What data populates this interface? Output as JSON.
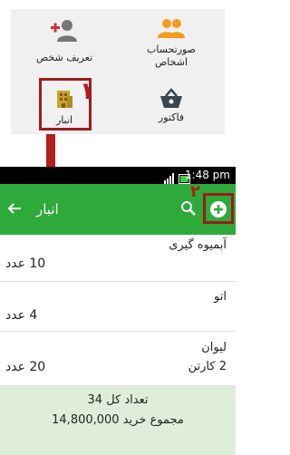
{
  "top_panel": {
    "tiles": [
      {
        "label": "تعریف شخص",
        "icon": "add-person-icon"
      },
      {
        "label": "صورتحساب\nاشخاص",
        "icon": "people-icon"
      },
      {
        "label": "انبار",
        "icon": "warehouse-icon"
      },
      {
        "label": "فاکتور",
        "icon": "basket-icon"
      }
    ],
    "marker1": "۱",
    "marker2": "۲"
  },
  "status_bar": {
    "time": "1:48 pm"
  },
  "toolbar": {
    "title": "انبار",
    "back_icon": "back-arrow-icon",
    "search_icon": "search-icon",
    "add_icon": "add-circle-icon"
  },
  "rows": [
    {
      "name": "آبمیوه گیری",
      "qty": "10 عدد",
      "sub": ""
    },
    {
      "name": "اتو",
      "qty": "4 عدد",
      "sub": ""
    },
    {
      "name": "لیوان",
      "qty": "20 عدد",
      "sub": "2 کارتن"
    }
  ],
  "footer": {
    "total_count": "تعداد کل 34",
    "total_purchase": "مجموع خرید 14,800,000"
  },
  "colors": {
    "toolbar": "#2eaa3a",
    "highlight": "#9b1c1c",
    "footer": "#dfeeda"
  }
}
